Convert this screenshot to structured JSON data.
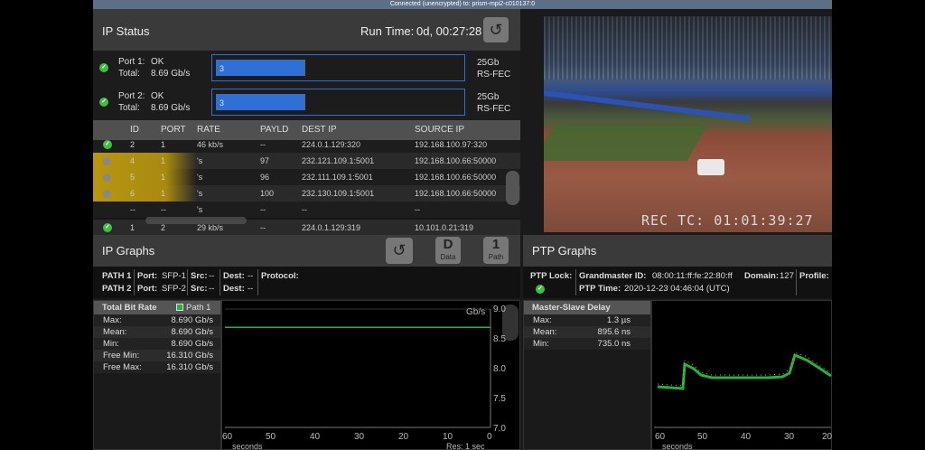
{
  "topbar": {
    "connection": "Connected (unencrypted) to: prism-mpi2-c010137:0"
  },
  "ip_status": {
    "title": "IP Status",
    "runtime_label": "Run Time:",
    "runtime_value": "0d, 00:27:28",
    "ports": [
      {
        "name": "Port 1:",
        "state": "OK",
        "total_label": "Total:",
        "total": "8.69 Gb/s",
        "bar_text": "3",
        "fill": 0.36,
        "speed": "25Gb",
        "fec": "RS-FEC"
      },
      {
        "name": "Port 2:",
        "state": "OK",
        "total_label": "Total:",
        "total": "8.69 Gb/s",
        "bar_text": "3",
        "fill": 0.36,
        "speed": "25Gb",
        "fec": "RS-FEC"
      }
    ],
    "columns": [
      "ID",
      "PORT",
      "RATE",
      "PAYLD",
      "DEST IP",
      "SOURCE IP"
    ],
    "rows": [
      {
        "id": "2",
        "port": "1",
        "rate": "46 kb/s",
        "payld": "--",
        "dest": "224.0.1.129:320",
        "source": "192.168.100.97:320"
      },
      {
        "id": "4",
        "port": "1",
        "rate": "'s",
        "payld": "97",
        "dest": "232.121.109.1:5001",
        "source": "192.168.100.66:50000"
      },
      {
        "id": "5",
        "port": "1",
        "rate": "'s",
        "payld": "96",
        "dest": "232.111.109.1:5001",
        "source": "192.168.100.66:50000"
      },
      {
        "id": "6",
        "port": "1",
        "rate": "'s",
        "payld": "100",
        "dest": "232.130.109.1:5001",
        "source": "192.168.100.66:50000"
      },
      {
        "id": "--",
        "port": "--",
        "rate": "'s",
        "payld": "--",
        "dest": "--",
        "source": "--"
      },
      {
        "id": "1",
        "port": "2",
        "rate": "29 kb/s",
        "payld": "--",
        "dest": "224.0.1.129:319",
        "source": "10.101.0.21:319"
      }
    ]
  },
  "video": {
    "rec_tc": "REC TC: 01:01:39:27"
  },
  "ip_graphs": {
    "title": "IP Graphs",
    "buttons": {
      "data_letter": "D",
      "data_label": "Data",
      "path_number": "1",
      "path_label": "Path"
    },
    "paths": [
      {
        "path": "PATH 1",
        "port_label": "Port:",
        "port": "SFP-1",
        "src_label": "Src:",
        "src": "--",
        "dest_label": "Dest:",
        "dest": "--",
        "protocol_label": "Protocol:"
      },
      {
        "path": "PATH 2",
        "port_label": "Port:",
        "port": "SFP-2",
        "src_label": "Src:",
        "src": "--",
        "dest_label": "Dest:",
        "dest": "--"
      }
    ],
    "stats_title": "Total Bit Rate",
    "stats_path": "Path 1",
    "stats": [
      {
        "label": "Max:",
        "value": "8.690 Gb/s"
      },
      {
        "label": "Mean:",
        "value": "8.690 Gb/s"
      },
      {
        "label": "Min:",
        "value": "8.690 Gb/s"
      },
      {
        "label": "Free Min:",
        "value": "16.310 Gb/s"
      },
      {
        "label": "Free Max:",
        "value": "16.310 Gb/s"
      }
    ],
    "unit": "Gb/s",
    "xlabel": "seconds",
    "res": "Res: 1 sec",
    "y_ticks": [
      "9.0",
      "8.5",
      "8.0",
      "7.5",
      "7.0"
    ],
    "x_ticks": [
      "60",
      "50",
      "40",
      "30",
      "20",
      "10",
      "0"
    ]
  },
  "ptp_graphs": {
    "title": "PTP Graphs",
    "lock_label": "PTP Lock:",
    "gm_label": "Grandmaster ID:",
    "gm": "08:00:11:ff:fe:22:80:ff",
    "domain_label": "Domain:",
    "domain": "127",
    "profile_label": "Profile:",
    "time_label": "PTP Time:",
    "time": "2020-12-23 04:46:04 (UTC)",
    "stats_title": "Master-Slave Delay",
    "stats": [
      {
        "label": "Max:",
        "value": "1.3 µs"
      },
      {
        "label": "Mean:",
        "value": "895.6 ns"
      },
      {
        "label": "Min:",
        "value": "735.0 ns"
      }
    ],
    "xlabel": "seconds",
    "x_ticks": [
      "60",
      "50",
      "40",
      "30",
      "20"
    ]
  },
  "colors": {
    "accent_blue": "#2f6fd6",
    "ok_green": "#3fbf3f",
    "plot_green": "#2fae3f"
  },
  "chart_data": [
    {
      "type": "line",
      "series": [
        {
          "name": "Path 1",
          "x": [
            60,
            0
          ],
          "y": [
            8.69,
            8.69
          ]
        }
      ],
      "ylabel": "Gb/s",
      "xlabel": "seconds",
      "xlim": [
        60,
        0
      ],
      "ylim": [
        7.0,
        9.0
      ]
    }
  ]
}
